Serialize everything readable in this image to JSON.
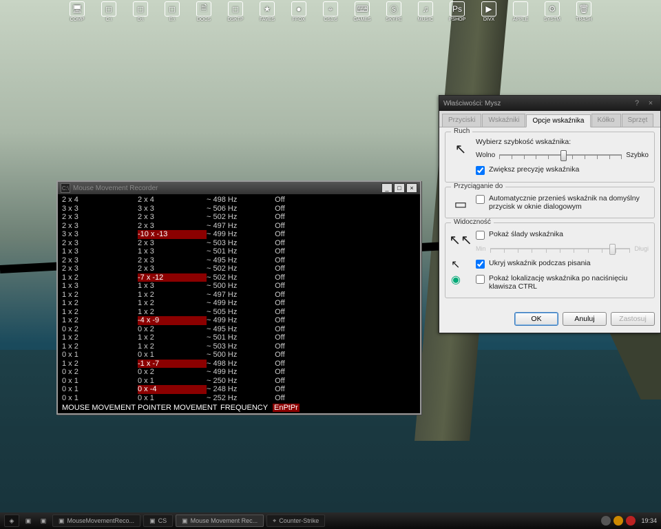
{
  "dock": [
    {
      "label": "COMP",
      "glyph": "🖥"
    },
    {
      "label": "C:\\",
      "glyph": "◻"
    },
    {
      "label": "D:\\",
      "glyph": "◻"
    },
    {
      "label": "E:\\",
      "glyph": "◻"
    },
    {
      "label": "DOCS",
      "glyph": "🗎"
    },
    {
      "label": "DSKTP",
      "glyph": "◻"
    },
    {
      "label": "FAVES",
      "glyph": "★"
    },
    {
      "label": "FFOX",
      "glyph": "●"
    },
    {
      "label": "CS1.6",
      "glyph": "⌖"
    },
    {
      "label": "GAMES",
      "glyph": "⌨"
    },
    {
      "label": "SKYPE",
      "glyph": "Ⓢ"
    },
    {
      "label": "MUSIC",
      "glyph": "♫"
    },
    {
      "label": "PSHOP",
      "glyph": "Ps"
    },
    {
      "label": "DIVX",
      "glyph": "▶"
    },
    {
      "label": "APPLE",
      "glyph": ""
    },
    {
      "label": "SYSTM",
      "glyph": "⚙"
    },
    {
      "label": "TRASH",
      "glyph": "🗑"
    }
  ],
  "console": {
    "title": "Mouse Movement Recorder",
    "footer": {
      "c1": "MOUSE MOVEMENT",
      "c2": "POINTER MOVEMENT",
      "c3": "FREQUENCY",
      "c4": "EnPtPr"
    },
    "rows": [
      {
        "m": "2 x 4",
        "p": "2 x 4",
        "f": "~ 498 Hz",
        "s": "Off",
        "hl": false
      },
      {
        "m": "3 x 3",
        "p": "3 x 3",
        "f": "~ 506 Hz",
        "s": "Off",
        "hl": false
      },
      {
        "m": "2 x 3",
        "p": "2 x 3",
        "f": "~ 502 Hz",
        "s": "Off",
        "hl": false
      },
      {
        "m": "2 x 3",
        "p": "2 x 3",
        "f": "~ 497 Hz",
        "s": "Off",
        "hl": false
      },
      {
        "m": "3 x 3",
        "p": "-10 x -13",
        "f": "~ 499 Hz",
        "s": "Off",
        "hl": true
      },
      {
        "m": "2 x 3",
        "p": "2 x 3",
        "f": "~ 503 Hz",
        "s": "Off",
        "hl": false
      },
      {
        "m": "1 x 3",
        "p": "1 x 3",
        "f": "~ 501 Hz",
        "s": "Off",
        "hl": false
      },
      {
        "m": "2 x 3",
        "p": "2 x 3",
        "f": "~ 495 Hz",
        "s": "Off",
        "hl": false
      },
      {
        "m": "2 x 3",
        "p": "2 x 3",
        "f": "~ 502 Hz",
        "s": "Off",
        "hl": false
      },
      {
        "m": "1 x 2",
        "p": "-7 x -12",
        "f": "~ 502 Hz",
        "s": "Off",
        "hl": true
      },
      {
        "m": "1 x 3",
        "p": "1 x 3",
        "f": "~ 500 Hz",
        "s": "Off",
        "hl": false
      },
      {
        "m": "1 x 2",
        "p": "1 x 2",
        "f": "~ 497 Hz",
        "s": "Off",
        "hl": false
      },
      {
        "m": "1 x 2",
        "p": "1 x 2",
        "f": "~ 499 Hz",
        "s": "Off",
        "hl": false
      },
      {
        "m": "1 x 2",
        "p": "1 x 2",
        "f": "~ 505 Hz",
        "s": "Off",
        "hl": false
      },
      {
        "m": "1 x 2",
        "p": "-4 x -9",
        "f": "~ 499 Hz",
        "s": "Off",
        "hl": true
      },
      {
        "m": "0 x 2",
        "p": "0 x 2",
        "f": "~ 495 Hz",
        "s": "Off",
        "hl": false
      },
      {
        "m": "1 x 2",
        "p": "1 x 2",
        "f": "~ 501 Hz",
        "s": "Off",
        "hl": false
      },
      {
        "m": "1 x 2",
        "p": "1 x 2",
        "f": "~ 503 Hz",
        "s": "Off",
        "hl": false
      },
      {
        "m": "0 x 1",
        "p": "0 x 1",
        "f": "~ 500 Hz",
        "s": "Off",
        "hl": false
      },
      {
        "m": "1 x 2",
        "p": "-1 x -7",
        "f": "~ 498 Hz",
        "s": "Off",
        "hl": true
      },
      {
        "m": "0 x 2",
        "p": "0 x 2",
        "f": "~ 499 Hz",
        "s": "Off",
        "hl": false
      },
      {
        "m": "0 x 1",
        "p": "0 x 1",
        "f": "~ 250 Hz",
        "s": "Off",
        "hl": false
      },
      {
        "m": "0 x 1",
        "p": "0 x -4",
        "f": "~ 248 Hz",
        "s": "Off",
        "hl": true
      },
      {
        "m": "0 x 1",
        "p": "0 x 1",
        "f": "~ 252 Hz",
        "s": "Off",
        "hl": false
      }
    ]
  },
  "dialog": {
    "title": "Właściwości: Mysz",
    "tabs": [
      "Przyciski",
      "Wskaźniki",
      "Opcje wskaźnika",
      "Kółko",
      "Sprzęt"
    ],
    "activeTab": 2,
    "groups": {
      "motion": {
        "legend": "Ruch",
        "label": "Wybierz szybkość wskaźnika:",
        "slow": "Wolno",
        "fast": "Szybko",
        "sliderPercent": 50,
        "enhance": {
          "checked": true,
          "label": "Zwiększ precyzję wskaźnika"
        }
      },
      "snap": {
        "legend": "Przyciąganie do",
        "opt": {
          "checked": false,
          "label": "Automatycznie przenieś wskaźnik na domyślny przycisk w oknie dialogowym"
        }
      },
      "visibility": {
        "legend": "Widoczność",
        "trails": {
          "checked": false,
          "label": "Pokaż ślady wskaźnika"
        },
        "trailSliderPercent": 85,
        "hide": {
          "checked": true,
          "label": "Ukryj wskaźnik podczas pisania"
        },
        "ctrl": {
          "checked": false,
          "label": "Pokaż lokalizację wskaźnika po naciśnięciu klawisza CTRL"
        }
      }
    },
    "buttons": {
      "ok": "OK",
      "cancel": "Anuluj",
      "apply": "Zastosuj"
    }
  },
  "taskbar": {
    "tasks": [
      {
        "label": "MouseMovementReco...",
        "active": false,
        "glyph": "▣"
      },
      {
        "label": "CS",
        "active": false,
        "glyph": "▣"
      },
      {
        "label": "Mouse Movement Rec...",
        "active": true,
        "glyph": "▣"
      },
      {
        "label": "Counter-Strike",
        "active": false,
        "glyph": "⌖"
      }
    ],
    "clock": "19:34"
  }
}
